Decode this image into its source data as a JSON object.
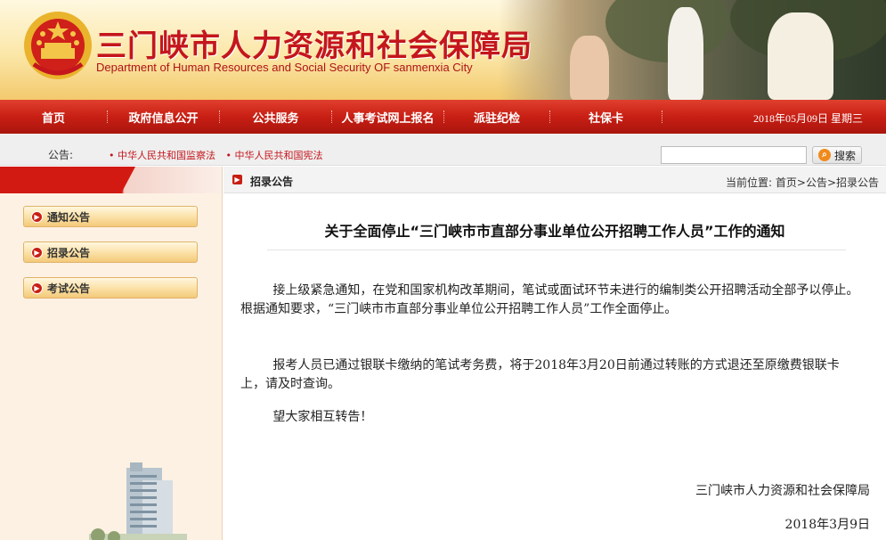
{
  "header": {
    "title_cn": "三门峡市人力资源和社会保障局",
    "title_en": "Department of Human Resources and Social Security OF sanmenxia City"
  },
  "nav": {
    "items": [
      "首页",
      "政府信息公开",
      "公共服务",
      "人事考试网上报名",
      "派驻纪检",
      "社保卡"
    ],
    "date": "2018年05月09日  星期三"
  },
  "notice": {
    "label": "公告:",
    "links": [
      "• 中华人民共和国监察法",
      "• 中华人民共和国宪法"
    ]
  },
  "search": {
    "placeholder": "",
    "button_label": "搜索"
  },
  "sidebar": {
    "items": [
      "通知公告",
      "招录公告",
      "考试公告"
    ]
  },
  "content": {
    "section_title": "招录公告",
    "breadcrumb": "当前位置: 首页>公告>招录公告",
    "article_title": "关于全面停止“三门峡市市直部分事业单位公开招聘工作人员”工作的通知",
    "paragraphs": [
      "接上级紧急通知，在党和国家机构改革期间，笔试或面试环节未进行的编制类公开招聘活动全部予以停止。根据通知要求，“三门峡市市直部分事业单位公开招聘工作人员”工作全面停止。",
      "报考人员已通过银联卡缴纳的笔试考务费，将于2018年3月20日前通过转账的方式退还至原缴费银联卡上，请及时查询。",
      "望大家相互转告！"
    ],
    "signature": "三门峡市人力资源和社会保障局",
    "sign_date": "2018年3月9日"
  },
  "colors": {
    "brand_red": "#c4161c",
    "nav_red": "#c81f14",
    "sidebar_bg": "#fdf1e3"
  }
}
